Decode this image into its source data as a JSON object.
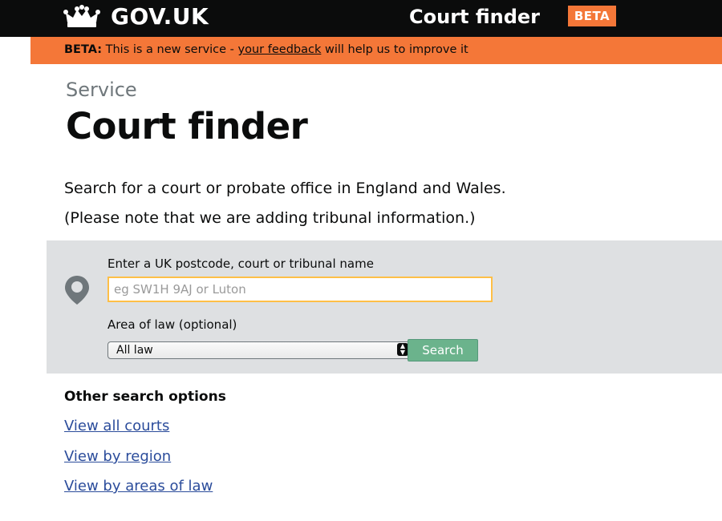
{
  "header": {
    "logo_text": "GOV.UK",
    "crown_icon": "crown-icon",
    "app_name": "Court finder",
    "beta_tag": "BETA"
  },
  "phase_banner": {
    "label": "BETA:",
    "text_before": "This is a new service -",
    "link_text": "your feedback",
    "text_after": "will help us to improve it"
  },
  "page": {
    "caption": "Service",
    "title": "Court finder",
    "lede1": "Search for a court or probate office in England and Wales.",
    "lede2": "(Please note that we are adding tribunal information.)"
  },
  "search": {
    "icon": "map-pin-icon",
    "label": "Enter a UK postcode, court or tribunal name",
    "placeholder": "eg SW1H 9AJ or Luton",
    "value": "",
    "area_label": "Area of law (optional)",
    "area_selected": "All law",
    "button_label": "Search"
  },
  "other": {
    "heading": "Other search options",
    "links": [
      "View all courts",
      "View by region",
      "View by areas of law"
    ]
  },
  "colors": {
    "header_bg": "#0b0c0c",
    "beta_orange": "#f47738",
    "panel_grey": "#dee0e2",
    "focus_yellow": "#ffbf47",
    "button_green": "#6bb38c",
    "link_blue": "#2b4c9b"
  }
}
